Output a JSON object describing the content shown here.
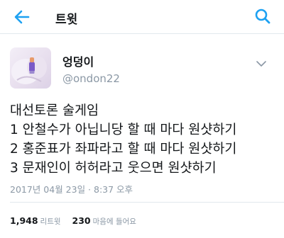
{
  "header": {
    "title": "트윗",
    "back_icon": "arrow-left-icon",
    "search_icon": "search-icon",
    "accent_color": "#1da1f2"
  },
  "tweet": {
    "display_name": "엉덩이",
    "handle": "@ondon22",
    "text_lines": [
      "대선토론 술게임",
      "1 안철수가 아닙니당 할 때 마다 원샷하기",
      "2 홍준표가 좌파라고 할 때 마다 원샷하기",
      "3 문재인이 허허라고 웃으면 원샷하기"
    ],
    "timestamp": "2017년 04월 23일 · 8:37 오후"
  },
  "stats": {
    "retweets_count": "1,948",
    "retweets_label": "리트윗",
    "likes_count": "230",
    "likes_label": "마음에 들어요"
  }
}
